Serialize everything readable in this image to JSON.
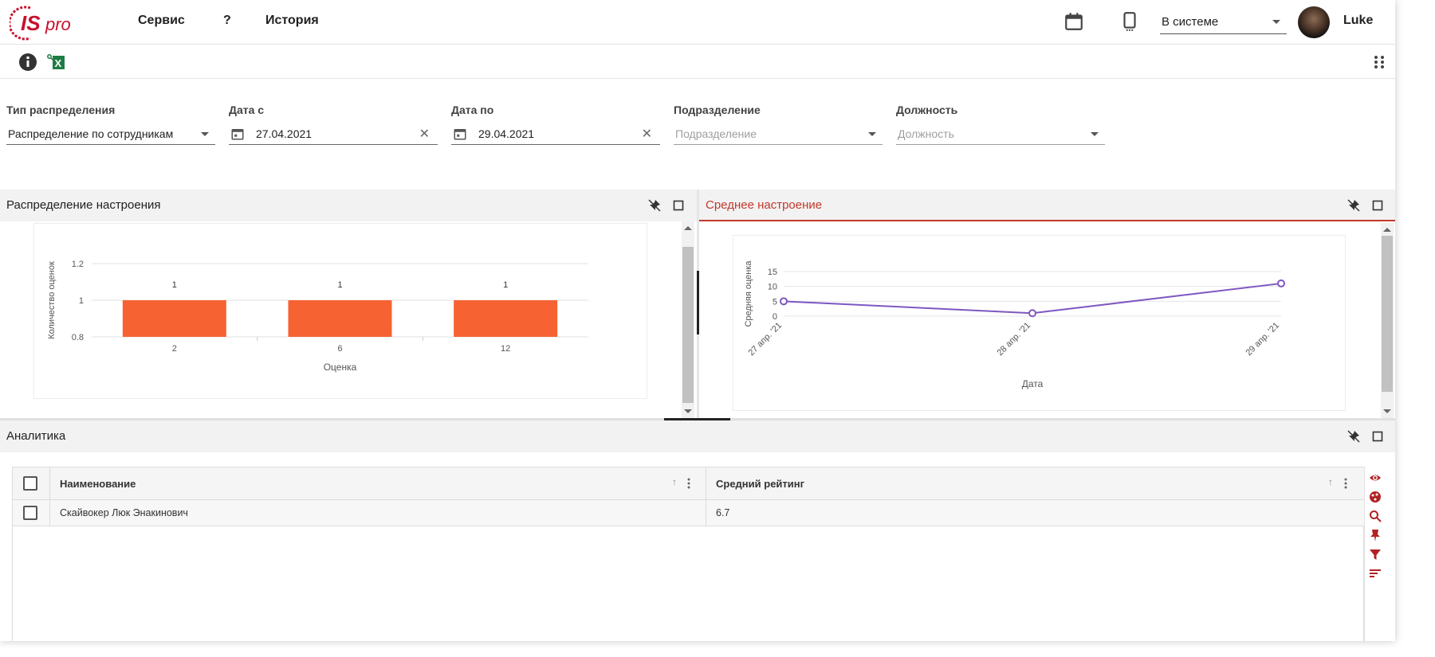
{
  "header": {
    "logo_text": "ISpro",
    "menu": [
      {
        "label": "Сервис"
      },
      {
        "label": "?"
      },
      {
        "label": "История"
      }
    ],
    "status_value": "В системе",
    "user_name": "Luke"
  },
  "filters": {
    "type": {
      "label": "Тип распределения",
      "value": "Распределение по сотрудникам"
    },
    "date_from": {
      "label": "Дата с",
      "value": "27.04.2021"
    },
    "date_to": {
      "label": "Дата по",
      "value": "29.04.2021"
    },
    "department": {
      "label": "Подразделение",
      "placeholder": "Подразделение"
    },
    "position": {
      "label": "Должность",
      "placeholder": "Должность"
    }
  },
  "panels": {
    "mood_distribution": {
      "title": "Распределение настроения"
    },
    "avg_mood": {
      "title": "Среднее настроение"
    },
    "analytics": {
      "title": "Аналитика"
    }
  },
  "chart_data": [
    {
      "type": "bar",
      "categories": [
        "2",
        "6",
        "12"
      ],
      "values": [
        1,
        1,
        1
      ],
      "data_labels": [
        "1",
        "1",
        "1"
      ],
      "xlabel": "Оценка",
      "ylabel": "Количество оценок",
      "yticks": [
        "0.8",
        "1",
        "1.2"
      ],
      "ylim": [
        0.8,
        1.2
      ],
      "grid": true,
      "color": "#f76233"
    },
    {
      "type": "line",
      "categories": [
        "27 апр. '21",
        "28 апр. '21",
        "29 апр. '21"
      ],
      "values": [
        5,
        1,
        11
      ],
      "xlabel": "Дата",
      "ylabel": "Средняя оценка",
      "yticks": [
        "0",
        "5",
        "10",
        "15"
      ],
      "ylim": [
        0,
        15
      ],
      "grid": true,
      "color": "#7e57c2"
    }
  ],
  "table": {
    "columns": [
      {
        "label": "Наименование"
      },
      {
        "label": "Средний рейтинг"
      }
    ],
    "rows": [
      {
        "name": "Скайвокер Люк Энакинович",
        "rating": "6.7"
      }
    ]
  },
  "colors": {
    "accent": "#c0392b",
    "bar": "#f76233",
    "line": "#7e57c2"
  }
}
